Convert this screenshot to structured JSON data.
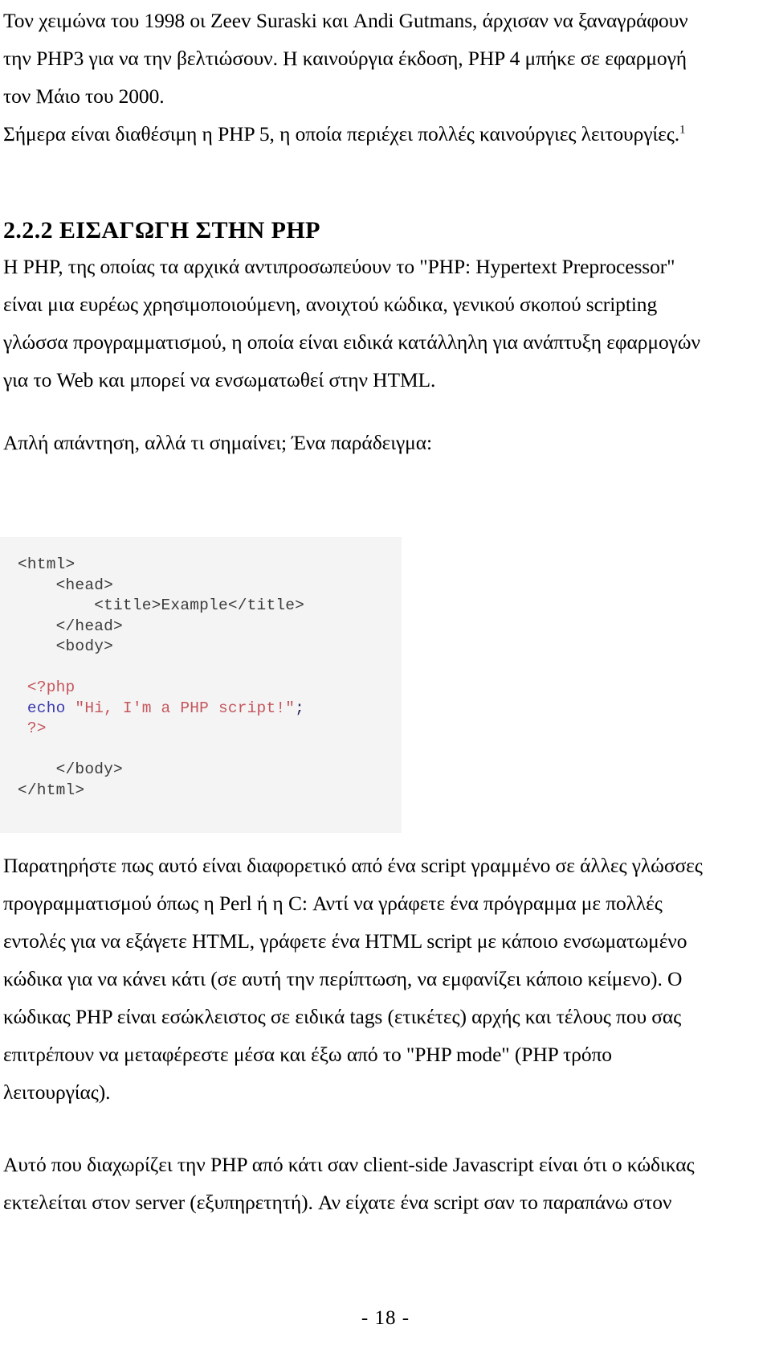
{
  "document": {
    "page_number_label": "- 18 -",
    "intro_paragraph": {
      "lines": [
        "Τον χειμώνα του 1998 οι Zeev Suraski και Andi Gutmans, άρχισαν να ξαναγράφουν",
        "την PHP3 για να την βελτιώσουν. Η καινούργια έκδοση, PHP 4 μπήκε σε εφαρμογή",
        "τον Μάιο του 2000.",
        "Σήμερα είναι διαθέσιμη η PHP 5, η οποία περιέχει πολλές καινούργιες λειτουργίες."
      ],
      "footnote_marker": "1"
    },
    "section": {
      "number": "2.2.2",
      "title": "ΕΙΣΑΓΩΓΗ ΣΤΗΝ PHP",
      "heading_full": "2.2.2 ΕΙΣΑΓΩΓΗ ΣΤΗΝ PHP"
    },
    "paragraph_1": {
      "lines": [
        "Η PHP, της οποίας τα αρχικά αντιπροσωπεύουν το \"PHP: Hypertext Preprocessor\"",
        "είναι μια ευρέως χρησιμοποιούμενη, ανοιχτού κώδικα, γενικού σκοπού scripting",
        "γλώσσα προγραμματισμού, η οποία είναι ειδικά κατάλληλη για ανάπτυξη εφαρμογών",
        "για το Web και μπορεί να ενσωματωθεί στην HTML."
      ]
    },
    "lead_in": {
      "text": "Απλή απάντηση, αλλά τι σημαίνει; Ένα παράδειγμα:"
    },
    "code_example": {
      "language": "html-php",
      "lines": [
        {
          "indent": 0,
          "tokens": [
            {
              "text": "<html>",
              "type": "tag"
            }
          ]
        },
        {
          "indent": 4,
          "tokens": [
            {
              "text": "<head>",
              "type": "tag"
            }
          ]
        },
        {
          "indent": 8,
          "tokens": [
            {
              "text": "<title>Example</title>",
              "type": "tag"
            }
          ]
        },
        {
          "indent": 4,
          "tokens": [
            {
              "text": "</head>",
              "type": "tag"
            }
          ]
        },
        {
          "indent": 4,
          "tokens": [
            {
              "text": "<body>",
              "type": "tag"
            }
          ]
        },
        {
          "indent": 0,
          "tokens": []
        },
        {
          "indent": 1,
          "tokens": [
            {
              "text": "<?php",
              "type": "php"
            }
          ]
        },
        {
          "indent": 1,
          "tokens": [
            {
              "text": "echo ",
              "type": "keyword"
            },
            {
              "text": "\"Hi, I'm a PHP script!\"",
              "type": "string"
            },
            {
              "text": ";",
              "type": "punct"
            }
          ]
        },
        {
          "indent": 1,
          "tokens": [
            {
              "text": "?>",
              "type": "php"
            }
          ]
        },
        {
          "indent": 0,
          "tokens": []
        },
        {
          "indent": 4,
          "tokens": [
            {
              "text": "</body>",
              "type": "tag"
            }
          ]
        },
        {
          "indent": 0,
          "tokens": [
            {
              "text": "</html>",
              "type": "tag"
            }
          ]
        }
      ],
      "plain_text": "<html>\n    <head>\n        <title>Example</title>\n    </head>\n    <body>\n\n <?php\n echo \"Hi, I'm a PHP script!\";\n ?>\n\n    </body>\n</html>",
      "background_color": "#f4f4f4"
    },
    "paragraph_2": {
      "lines": [
        "Παρατηρήστε πως αυτό είναι διαφορετικό από ένα script γραμμένο σε άλλες γλώσσες",
        "προγραμματισμού όπως η Perl ή η C: Αντί να γράφετε ένα πρόγραμμα με πολλές",
        "εντολές για να εξάγετε HTML, γράφετε ένα HTML script με κάποιο ενσωματωμένο",
        "κώδικα για να κάνει κάτι (σε αυτή την περίπτωση, να εμφανίζει κάποιο κείμενο). Ο",
        "κώδικας PHP είναι εσώκλειστος σε ειδικά tags (ετικέτες) αρχής και τέλους που σας",
        "επιτρέπουν να μεταφέρεστε μέσα και έξω από το \"PHP mode\" (PHP τρόπο",
        "λειτουργίας)."
      ]
    },
    "paragraph_3": {
      "lines": [
        "Αυτό που διαχωρίζει την PHP από κάτι σαν client-side Javascript είναι ότι ο κώδικας",
        "εκτελείται στον server (εξυπηρετητή). Αν είχατε ένα script σαν το παραπάνω στον"
      ]
    },
    "colors": {
      "text": "#000000",
      "code_text": "#3b3b3b",
      "code_php_tag": "#c4565c",
      "code_keyword": "#3a3ab0",
      "code_string": "#c4565c",
      "code_background": "#f4f4f4",
      "page_background": "#ffffff"
    }
  }
}
